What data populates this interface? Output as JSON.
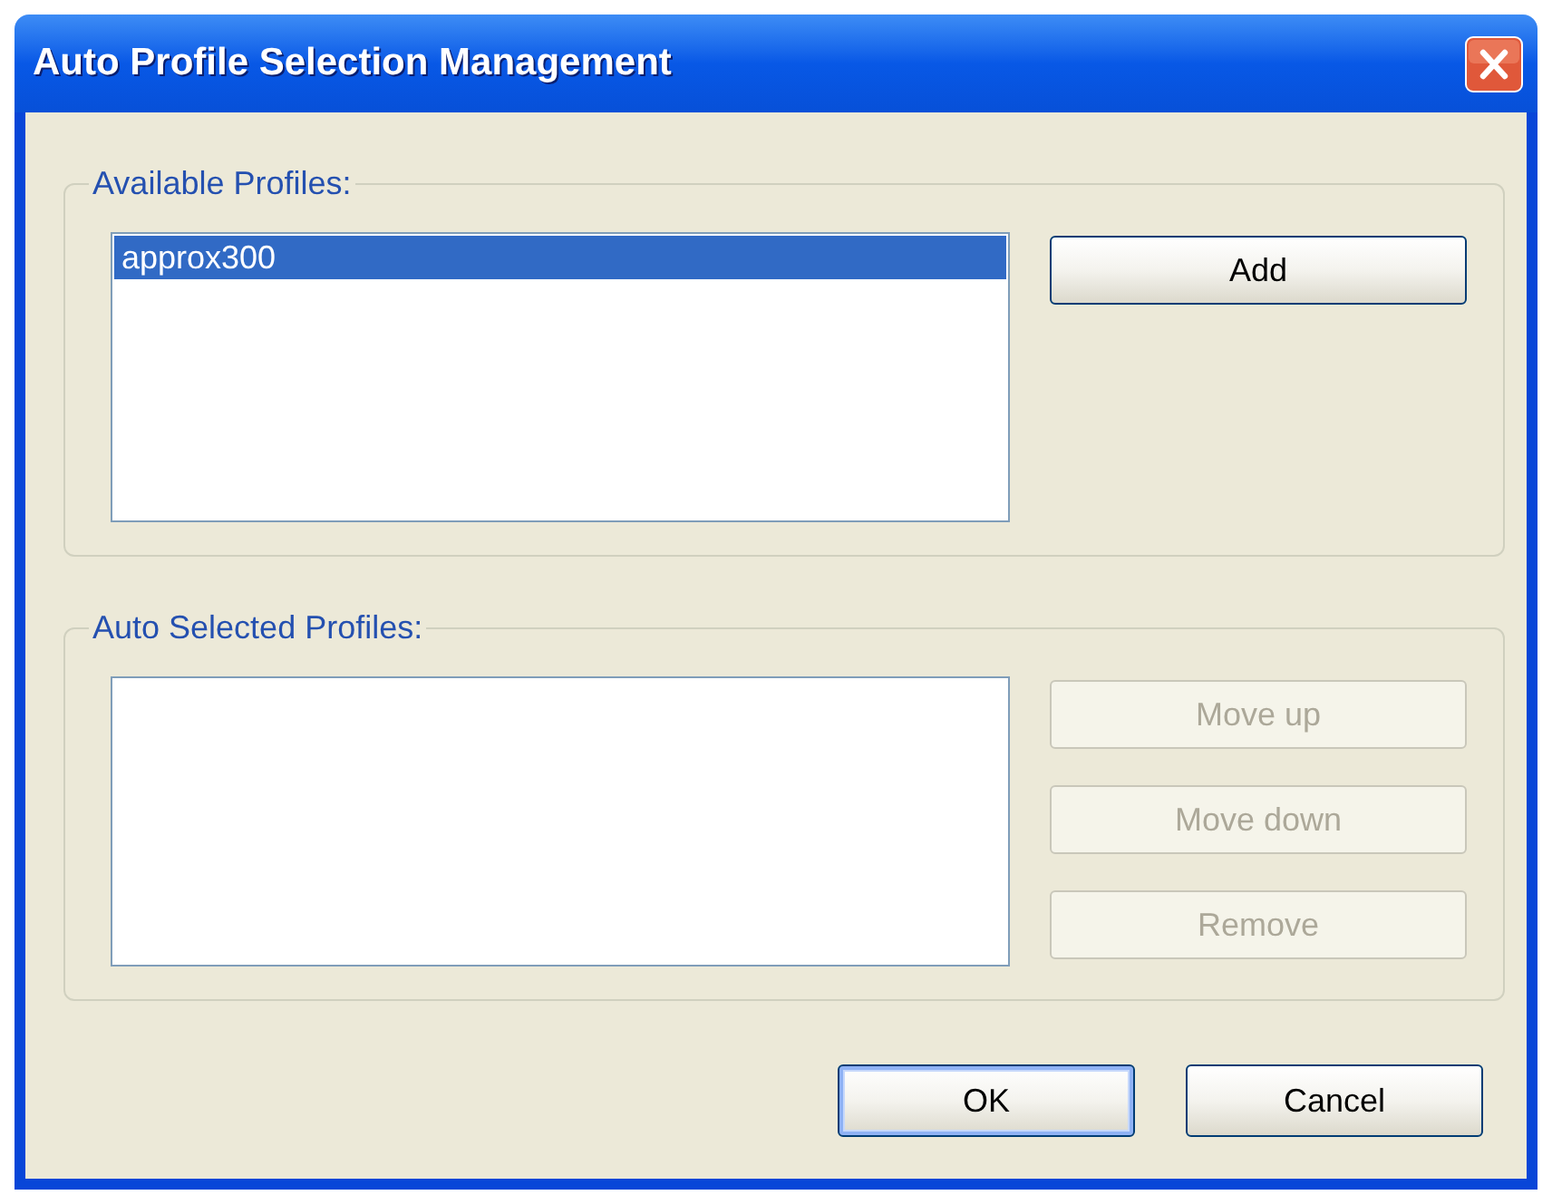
{
  "window": {
    "title": "Auto Profile Selection Management"
  },
  "groups": [
    {
      "label": "Available Profiles:",
      "items": [
        {
          "text": "approx300",
          "selected": true
        }
      ],
      "buttons": [
        {
          "label": "Add",
          "disabled": false
        }
      ]
    },
    {
      "label": "Auto Selected Profiles:",
      "buttons": [
        {
          "label": "Move up",
          "disabled": true
        },
        {
          "label": "Move down",
          "disabled": true
        },
        {
          "label": "Remove",
          "disabled": true
        }
      ]
    }
  ],
  "dialog_buttons": [
    {
      "label": "OK",
      "default": true
    },
    {
      "label": "Cancel",
      "default": false
    }
  ]
}
